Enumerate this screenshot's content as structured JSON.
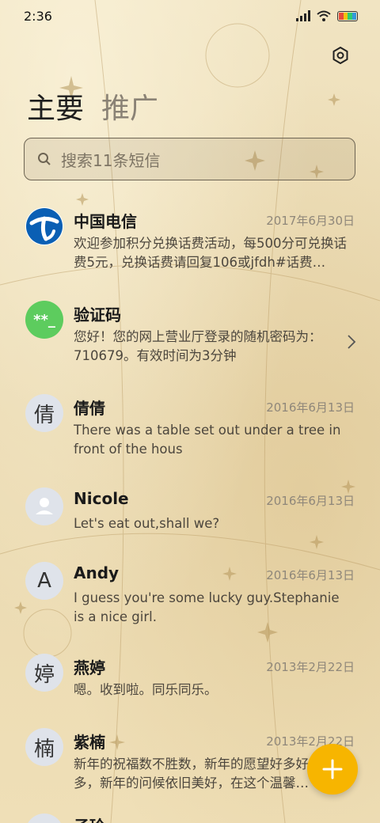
{
  "status_bar": {
    "time": "2:36"
  },
  "tabs": [
    {
      "label": "主要"
    },
    {
      "label": "推广"
    }
  ],
  "search": {
    "placeholder": "搜索11条短信"
  },
  "messages": [
    {
      "sender": "中国电信",
      "date": "2017年6月30日",
      "preview": "欢迎参加积分兑换话费活动，每500分可兑换话费5元，兑换话费请回复106或jfdh#话费…",
      "avatar_type": "telecom-logo"
    },
    {
      "sender": "验证码",
      "date": "",
      "preview": "您好！您的网上营业厅登录的随机密码为：710679。有效时间为3分钟",
      "avatar_type": "code",
      "avatar_text": "**_"
    },
    {
      "sender": "倩倩",
      "date": "2016年6月13日",
      "preview": "There was a table set out under a tree in front of the hous",
      "avatar_text": "倩"
    },
    {
      "sender": "Nicole",
      "date": "2016年6月13日",
      "preview": "Let's eat out,shall we?",
      "avatar_type": "person"
    },
    {
      "sender": "Andy",
      "date": "2016年6月13日",
      "preview": "I guess you're some lucky guy.Stephanie is a nice girl.",
      "avatar_text": "A"
    },
    {
      "sender": "燕婷",
      "date": "2013年2月22日",
      "preview": "嗯。收到啦。同乐同乐。",
      "avatar_text": "婷"
    },
    {
      "sender": "紫楠",
      "date": "2013年2月22日",
      "preview": "新年的祝福数不胜数，新年的愿望好多好多，新年的问候依旧美好，在这个温馨的时刻",
      "avatar_text": "楠"
    },
    {
      "sender": "子玲",
      "date": "",
      "preview": "",
      "avatar_text": ""
    }
  ],
  "colors": {
    "accent": "#f7b500",
    "code_avatar": "#5dcc5e",
    "telecom_blue": "#0a5fb4"
  },
  "icons": {
    "settings": "settings-icon",
    "search": "search-icon",
    "compose": "plus-icon"
  }
}
